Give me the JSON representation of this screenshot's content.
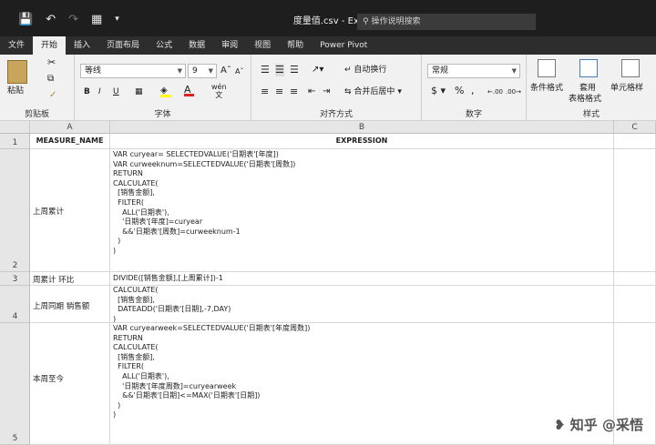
{
  "titlebar": {
    "filename": "度量值.csv",
    "app": "Excel",
    "tellme": "操作说明搜索"
  },
  "tabs": [
    "文件",
    "开始",
    "插入",
    "页面布局",
    "公式",
    "数据",
    "审阅",
    "视图",
    "帮助",
    "Power Pivot"
  ],
  "ribbon": {
    "clipboard": {
      "paste": "粘贴",
      "label": "剪贴板"
    },
    "font": {
      "name": "等线",
      "size": "9",
      "bold": "B",
      "italic": "I",
      "underline": "U",
      "grow": "A",
      "shrink": "A",
      "wen": "wén",
      "label": "字体"
    },
    "align": {
      "wrap": "自动换行",
      "merge": "合并后居中",
      "label": "对齐方式"
    },
    "number": {
      "format": "常规",
      "currency": "$",
      "percent": "%",
      "comma": ",",
      "label": "数字"
    },
    "styles": {
      "cond": "条件格式",
      "table": "套用",
      "table2": "表格格式",
      "cell": "单元格样",
      "label": "样式"
    }
  },
  "grid": {
    "columns": [
      "A",
      "B",
      "C"
    ],
    "rows": [
      {
        "num": "1",
        "a": "MEASURE_NAME",
        "b": "EXPRESSION"
      },
      {
        "num": "2",
        "a": "上周累计",
        "b": "VAR curyear= SELECTEDVALUE('日期表'[年度])\nVAR curweeknum=SELECTEDVALUE('日期表'[周数])\nRETURN\nCALCULATE(\n  [销售金额],\n  FILTER(\n    ALL('日期表'),\n    '日期表'[年度]=curyear\n    &&'日期表'[周数]=curweeknum-1\n  )\n)"
      },
      {
        "num": "3",
        "a": "周累计 环比",
        "b": "DIVIDE([销售金额],[上周累计])-1"
      },
      {
        "num": "4",
        "a": "上周同期 销售额",
        "b": "CALCULATE(\n  [销售金额],\n  DATEADD('日期表'[日期],-7,DAY)\n)"
      },
      {
        "num": "5",
        "a": "本周至今",
        "b": "VAR curyearweek=SELECTEDVALUE('日期表'[年度周数])\nRETURN\nCALCULATE(\n  [销售金额],\n  FILTER(\n    ALL('日期表'),\n    '日期表'[年度周数]=curyearweek\n    &&'日期表'[日期]<=MAX('日期表'[日期])\n  )\n)"
      }
    ]
  },
  "watermark": "知乎 @采悟"
}
